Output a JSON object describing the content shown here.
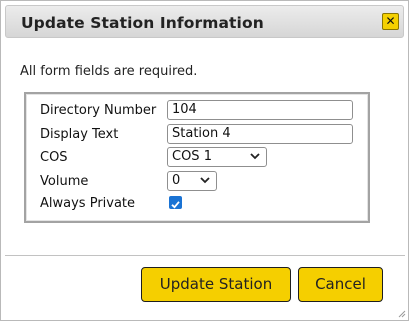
{
  "dialog": {
    "title": "Update Station Information",
    "close_icon": "close-icon"
  },
  "notice": "All form fields are required.",
  "form": {
    "directory_number": {
      "label": "Directory Number",
      "value": "104"
    },
    "display_text": {
      "label": "Display Text",
      "value": "Station 4"
    },
    "cos": {
      "label": "COS",
      "value": "COS 1"
    },
    "volume": {
      "label": "Volume",
      "value": "0"
    },
    "always_private": {
      "label": "Always Private",
      "checked": true
    }
  },
  "buttons": {
    "update": "Update Station",
    "cancel": "Cancel"
  },
  "colors": {
    "accent": "#f5cf00",
    "checkbox": "#1a73d4"
  }
}
